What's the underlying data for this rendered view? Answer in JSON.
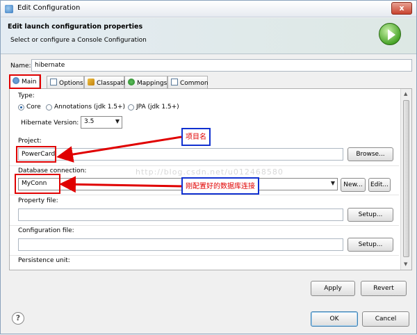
{
  "window": {
    "title": "Edit Configuration",
    "close_glyph": "x"
  },
  "banner": {
    "title": "Edit launch configuration properties",
    "subtitle": "Select or configure a Console Configuration"
  },
  "name": {
    "label": "Name:",
    "value": "hibernate"
  },
  "tabs": [
    {
      "label": "Main",
      "icon": "main-icon"
    },
    {
      "label": "Options",
      "icon": "options-icon"
    },
    {
      "label": "Classpath",
      "icon": "classpath-icon"
    },
    {
      "label": "Mappings",
      "icon": "mappings-icon"
    },
    {
      "label": "Common",
      "icon": "common-icon"
    }
  ],
  "main": {
    "type_label": "Type:",
    "type_options": [
      "Core",
      "Annotations (jdk 1.5+)",
      "JPA (jdk 1.5+)"
    ],
    "selected_type": "Core",
    "hibernate_version_label": "Hibernate Version:",
    "hibernate_version": "3.5",
    "project_label": "Project:",
    "project_value": "PowerCard",
    "browse_label": "Browse...",
    "db_connection_label": "Database connection:",
    "db_connection_value": "MyConn",
    "new_label": "New...",
    "edit_label": "Edit...",
    "property_file_label": "Property file:",
    "property_setup_label": "Setup...",
    "config_file_label": "Configuration file:",
    "config_setup_label": "Setup...",
    "persistence_unit_label": "Persistence unit:"
  },
  "footer": {
    "apply_label": "Apply",
    "revert_label": "Revert",
    "ok_label": "OK",
    "cancel_label": "Cancel"
  },
  "annotations": {
    "project_note": "项目名",
    "connection_note": "刚配置好的数据库连接",
    "watermark": "http://blog.csdn.net/u012468580"
  },
  "colors": {
    "annotation_red": "#e00000",
    "annotation_blue": "#1030d0"
  }
}
